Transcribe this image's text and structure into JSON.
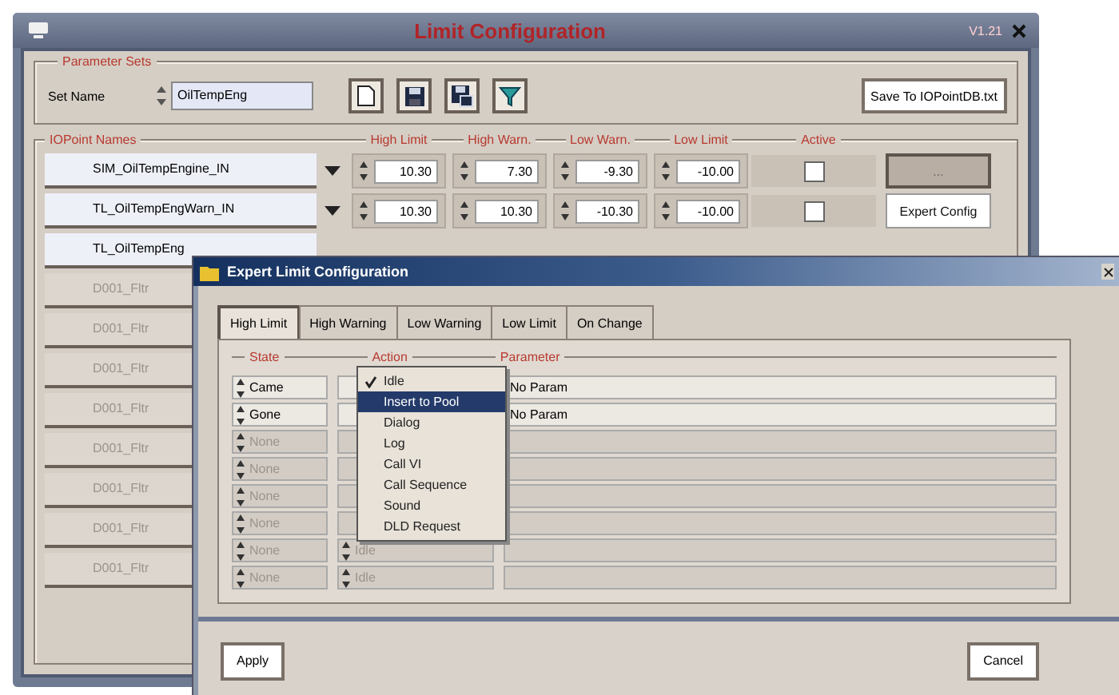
{
  "window": {
    "title": "Limit Configuration",
    "version": "V1.21"
  },
  "parameter_sets": {
    "legend": "Parameter Sets",
    "set_name_label": "Set Name",
    "set_name": "OilTempEng",
    "save_button": "Save To IOPointDB.txt"
  },
  "iopoints": {
    "legend": "IOPoint Names",
    "columns": [
      "High Limit",
      "High Warn.",
      "Low Warn.",
      "Low Limit",
      "Active"
    ],
    "rows": [
      {
        "name": "SIM_OilTempEngine_IN",
        "disabled": false,
        "values": [
          "10.30",
          "7.30",
          "-9.30",
          "-10.00"
        ],
        "active": false,
        "button": "..."
      },
      {
        "name": "TL_OilTempEngWarn_IN",
        "disabled": false,
        "values": [
          "10.30",
          "10.30",
          "-10.30",
          "-10.00"
        ],
        "active": false,
        "button": "Expert Config"
      },
      {
        "name": "TL_OilTempEng",
        "disabled": false
      },
      {
        "name": "D001_Fltr",
        "disabled": true
      },
      {
        "name": "D001_Fltr",
        "disabled": true
      },
      {
        "name": "D001_Fltr",
        "disabled": true
      },
      {
        "name": "D001_Fltr",
        "disabled": true
      },
      {
        "name": "D001_Fltr",
        "disabled": true
      },
      {
        "name": "D001_Fltr",
        "disabled": true
      },
      {
        "name": "D001_Fltr",
        "disabled": true
      },
      {
        "name": "D001_Fltr",
        "disabled": true
      }
    ]
  },
  "dialog": {
    "title": "Expert Limit Configuration",
    "tabs": [
      {
        "label": "High Limit",
        "selected": true
      },
      {
        "label": "High Warning",
        "selected": false
      },
      {
        "label": "Low Warning",
        "selected": false
      },
      {
        "label": "Low Limit",
        "selected": false
      },
      {
        "label": "On Change",
        "selected": false
      }
    ],
    "columns": [
      "State",
      "Action",
      "Parameter"
    ],
    "rows": [
      {
        "state": "Came",
        "parameter": "No Param",
        "disabled": false
      },
      {
        "state": "Gone",
        "parameter": "No Param",
        "disabled": false
      },
      {
        "state": "None",
        "disabled": true
      },
      {
        "state": "None",
        "disabled": true
      },
      {
        "state": "None",
        "disabled": true
      },
      {
        "state": "None",
        "disabled": true
      },
      {
        "state": "None",
        "action": "Idle",
        "disabled": true
      },
      {
        "state": "None",
        "action": "Idle",
        "disabled": true
      }
    ],
    "action_menu": [
      {
        "label": "Idle",
        "checked": true,
        "selected": false
      },
      {
        "label": "Insert to Pool",
        "checked": false,
        "selected": true
      },
      {
        "label": "Dialog",
        "checked": false,
        "selected": false
      },
      {
        "label": "Log",
        "checked": false,
        "selected": false
      },
      {
        "label": "Call VI",
        "checked": false,
        "selected": false
      },
      {
        "label": "Call Sequence",
        "checked": false,
        "selected": false
      },
      {
        "label": "Sound",
        "checked": false,
        "selected": false
      },
      {
        "label": "DLD Request",
        "checked": false,
        "selected": false
      }
    ],
    "buttons": [
      "Apply",
      "Cancel"
    ]
  }
}
